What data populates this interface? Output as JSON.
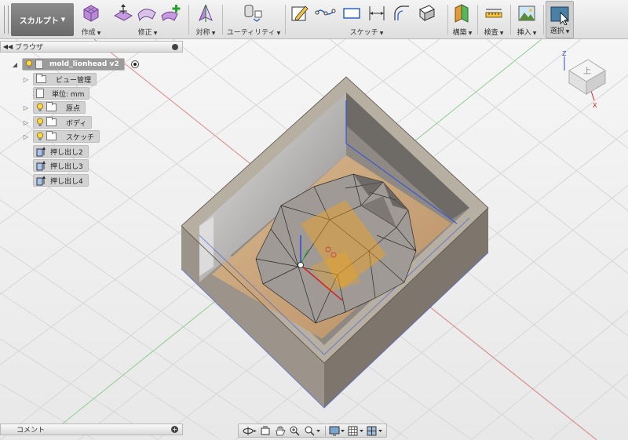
{
  "toolbar": {
    "workspace_label": "スカルプト",
    "groups": [
      {
        "label": "作成"
      },
      {
        "label": "修正"
      },
      {
        "label": "対称"
      },
      {
        "label": "ユーティリティ"
      },
      {
        "label": "スケッチ"
      },
      {
        "label": "構築"
      },
      {
        "label": "検査"
      },
      {
        "label": "挿入"
      },
      {
        "label": "選択"
      }
    ]
  },
  "browser": {
    "title": "ブラウザ",
    "root": {
      "label": "mold_lionhead v2"
    },
    "items": [
      {
        "label": "ビュー管理",
        "icon": "folder-icon"
      },
      {
        "label": "単位: mm",
        "icon": "document-icon"
      },
      {
        "label": "原点",
        "icon": "folder-icon"
      },
      {
        "label": "ボディ",
        "icon": "folder-icon"
      },
      {
        "label": "スケッチ",
        "icon": "folder-icon"
      },
      {
        "label": "押し出し2",
        "icon": "extrude-icon"
      },
      {
        "label": "押し出し3",
        "icon": "extrude-icon"
      },
      {
        "label": "押し出し4",
        "icon": "extrude-icon"
      }
    ]
  },
  "comments": {
    "title": "コメント"
  },
  "viewcube": {
    "face_label": "上"
  },
  "colors": {
    "toolbar_bg": "#e6e6e6",
    "selected_tool": "#4a7fa6",
    "canvas_bg": "#f3f3f3",
    "grid": "#d8d8d8",
    "mold_outer": "#b3a99b",
    "mold_inner": "#c4a27b",
    "mesh": "#a8a39e",
    "sketch_plane": "#f2a21c",
    "edge_blue": "#3a57d8"
  }
}
